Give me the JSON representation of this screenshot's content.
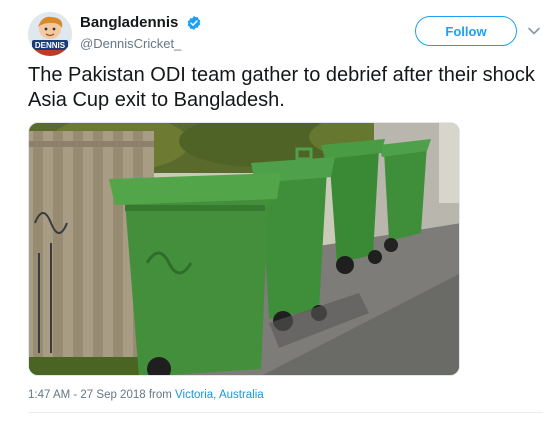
{
  "author": {
    "display_name": "Bangladennis",
    "handle": "@DennisCricket_",
    "avatar_icon": "cartoon-avatar-icon",
    "verified_icon": "verified-badge-icon",
    "avatar_badge_text": "DENNIS"
  },
  "header": {
    "follow_label": "Follow",
    "menu_icon": "chevron-down-icon"
  },
  "tweet": {
    "text": "The Pakistan ODI team gather to debrief after their shock Asia Cup exit to Bangladesh."
  },
  "media": {
    "description_icon": "photo-wheelie-bins"
  },
  "meta": {
    "timestamp": "1:47 AM - 27 Sep 2018",
    "from_label": "from",
    "location": "Victoria, Australia"
  },
  "colors": {
    "accent": "#1da1f2",
    "text": "#14171a",
    "muted": "#657786",
    "bin_green": "#3f8f3a"
  }
}
